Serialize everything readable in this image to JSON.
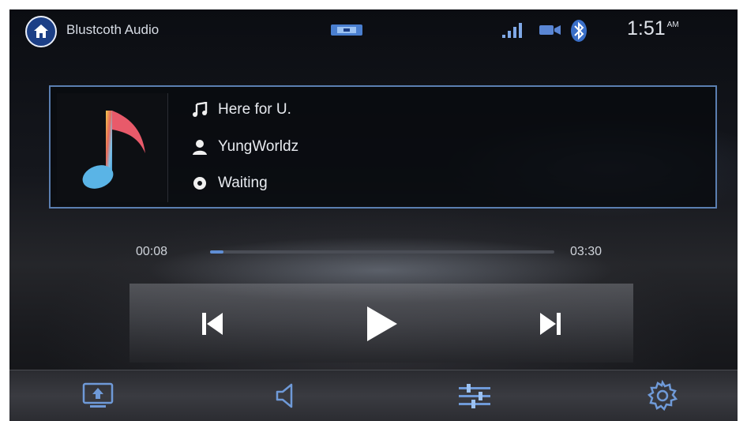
{
  "header": {
    "title": "Blustcoth Audio",
    "clock_time": "1:51",
    "clock_ampm": "AM",
    "icons": [
      "home-icon",
      "media-source-icon",
      "signal-strength-icon",
      "camera-icon",
      "bluetooth-icon"
    ]
  },
  "track": {
    "title": "Here for U.",
    "artist": "YungWorldz",
    "status": "Waiting",
    "icons": [
      "music-note-icon",
      "person-icon",
      "disc-icon"
    ]
  },
  "progress": {
    "elapsed": "00:08",
    "total": "03:30",
    "fraction": 0.04
  },
  "controls": [
    "previous-track-icon",
    "play-icon",
    "next-track-icon"
  ],
  "bottom_bar": [
    "source-screen-icon",
    "volume-icon",
    "equalizer-icon",
    "settings-gear-icon"
  ],
  "colors": {
    "accent": "#5f8ed4",
    "home_button": "#1c3f86",
    "panel_border": "#5b7fb1"
  }
}
